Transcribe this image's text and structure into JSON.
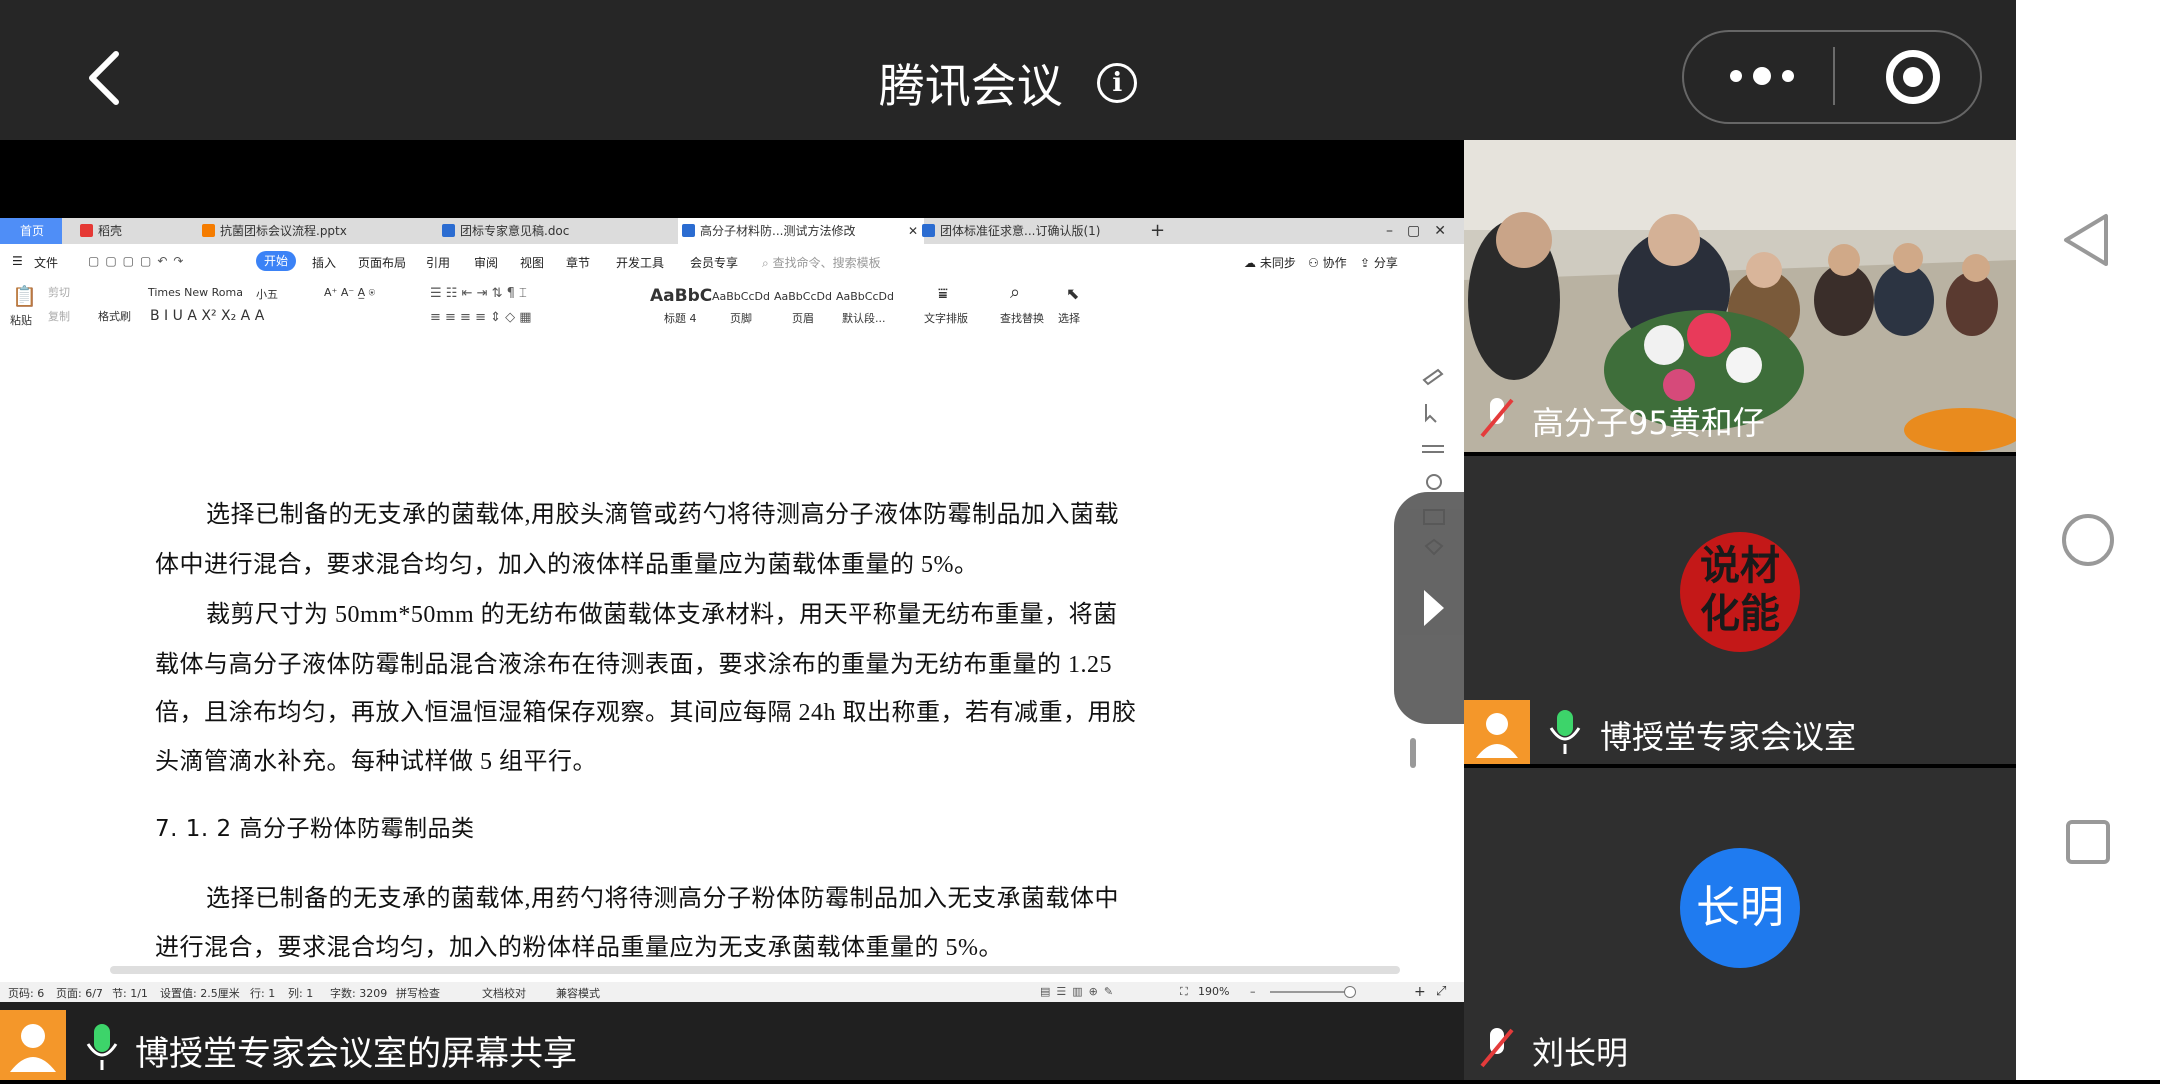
{
  "app": {
    "title": "腾讯会议"
  },
  "tabs": [
    {
      "label": "首页"
    },
    {
      "label": "稻壳"
    },
    {
      "label": "抗菌团标会议流程.pptx"
    },
    {
      "label": "团标专家意见稿.doc"
    },
    {
      "label": "高分子材料防...测试方法修改"
    },
    {
      "label": "团体标准征求意...订确认版(1)"
    }
  ],
  "menu": {
    "file": "文件",
    "items": [
      "开始",
      "插入",
      "页面布局",
      "引用",
      "审阅",
      "视图",
      "章节",
      "开发工具",
      "会员专享"
    ],
    "search_placeholder": "查找命令、搜索模板",
    "right": [
      "未同步",
      "协作",
      "分享"
    ]
  },
  "ribbon": {
    "paste": "粘贴",
    "cut": "剪切",
    "copy": "复制",
    "format_painter": "格式刷",
    "font_name": "Times New Roma",
    "font_size": "小五",
    "styles": [
      {
        "preview": "AaBbC",
        "label": "标题 4"
      },
      {
        "preview": "AaBbCcDd",
        "label": "页脚"
      },
      {
        "preview": "AaBbCcDd",
        "label": "页眉"
      },
      {
        "preview": "AaBbCcDd",
        "label": "默认段..."
      }
    ],
    "text_layout": "文字排版",
    "find_replace": "查找替换",
    "select": "选择"
  },
  "document": {
    "lines": [
      "选择已制备的无支承的菌载体,用胶头滴管或药勺将待测高分子液体防霉制品加入菌载",
      "体中进行混合，要求混合均匀，加入的液体样品重量应为菌载体重量的 5%。",
      "裁剪尺寸为 50mm*50mm 的无纺布做菌载体支承材料，用天平称量无纺布重量，将菌",
      "载体与高分子液体防霉制品混合液涂布在待测表面，要求涂布的重量为无纺布重量的 1.25",
      "倍，且涂布均匀，再放入恒温恒湿箱保存观察。其间应每隔 24h 取出称重，若有减重，用胶",
      "头滴管滴水补充。每种试样做 5 组平行。",
      "7. 1. 2  高分子粉体防霉制品类",
      "选择已制备的无支承的菌载体,用药勺将待测高分子粉体防霉制品加入无支承菌载体中",
      "进行混合，要求混合均匀，加入的粉体样品重量应为无支承菌载体重量的 5%。"
    ]
  },
  "statusbar": {
    "page_num": "页码: 6",
    "pages": "页面: 6/7",
    "section": "节: 1/1",
    "setting": "设置值: 2.5厘米",
    "row": "行: 1",
    "col": "列: 1",
    "words": "字数: 3209",
    "spell": "拼写检查",
    "doc_check": "文档校对",
    "compat": "兼容模式",
    "zoom": "190%"
  },
  "share": {
    "label": "博授堂专家会议室的屏幕共享"
  },
  "participants": [
    {
      "name": "高分子95黄和仔"
    },
    {
      "name": "博授堂专家会议室",
      "badge": [
        "说材",
        "化能"
      ]
    },
    {
      "name": "刘长明",
      "avatar_text": "长明"
    }
  ],
  "colors": {
    "topbar": "#262626",
    "accent": "#1f7bf0",
    "orange": "#f4972a",
    "wps_blue": "#3b82f6"
  }
}
